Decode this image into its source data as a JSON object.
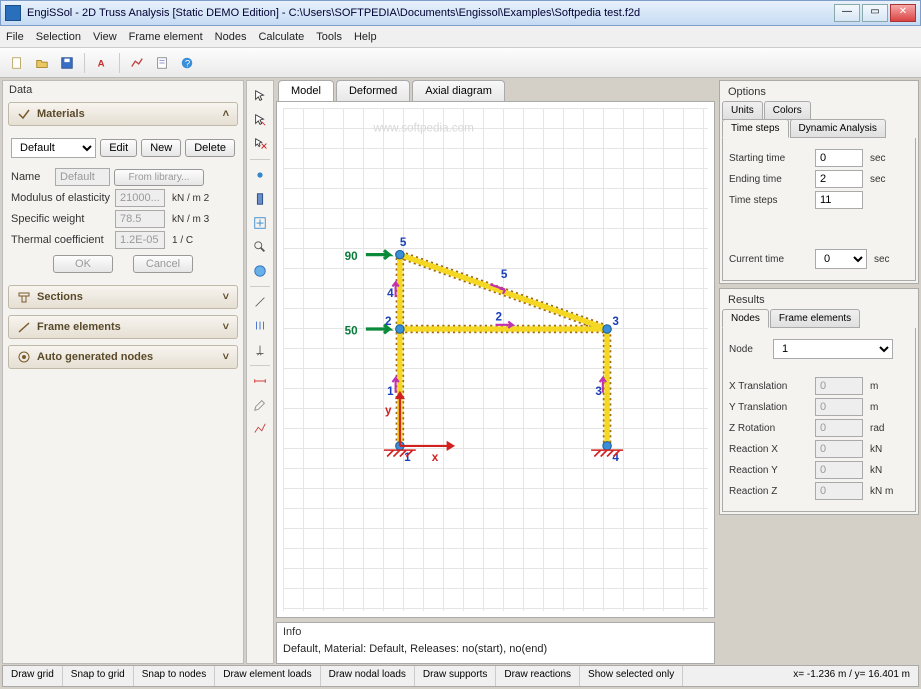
{
  "window": {
    "title": "EngiSSol - 2D Truss Analysis [Static DEMO Edition]   -  C:\\Users\\SOFTPEDIA\\Documents\\Engissol\\Examples\\Softpedia test.f2d"
  },
  "menu": [
    "File",
    "Selection",
    "View",
    "Frame element",
    "Nodes",
    "Calculate",
    "Tools",
    "Help"
  ],
  "data_panel": {
    "title": "Data",
    "sections": {
      "materials": {
        "label": "Materials",
        "combo": "Default",
        "btn_edit": "Edit",
        "btn_new": "New",
        "btn_delete": "Delete",
        "name_label": "Name",
        "name_value": "Default",
        "from_library": "From library...",
        "modulus_label": "Modulus of elasticity",
        "modulus_value": "21000...",
        "modulus_unit": "kN  /  m  2",
        "weight_label": "Specific weight",
        "weight_value": "78.5",
        "weight_unit": "kN  /  m  3",
        "thermal_label": "Thermal coefficient",
        "thermal_value": "1.2E-05",
        "thermal_unit": "1   /  C",
        "btn_ok": "OK",
        "btn_cancel": "Cancel"
      },
      "sections_label": "Sections",
      "frame_elements_label": "Frame elements",
      "auto_nodes_label": "Auto generated nodes"
    }
  },
  "center": {
    "tabs": [
      "Model",
      "Deformed",
      "Axial diagram"
    ],
    "watermark": "www.softpedia.com",
    "load_labels": {
      "top": "90",
      "mid": "50"
    },
    "node_labels": [
      "1",
      "2",
      "3",
      "4",
      "5"
    ],
    "element_labels": [
      "1",
      "2",
      "3",
      "4",
      "5"
    ],
    "axes": {
      "x": "x",
      "y": "y"
    },
    "info_title": "Info",
    "info_text": "Default, Material: Default, Releases: no(start), no(end)"
  },
  "options": {
    "title": "Options",
    "tabs": [
      "Units",
      "Colors",
      "Time steps",
      "Dynamic Analysis"
    ],
    "starting_time_label": "Starting time",
    "starting_time": "0",
    "ending_time_label": "Ending time",
    "ending_time": "2",
    "time_steps_label": "Time steps",
    "time_steps": "11",
    "current_time_label": "Current time",
    "current_time": "0",
    "sec": "sec"
  },
  "results": {
    "title": "Results",
    "tabs": [
      "Nodes",
      "Frame elements"
    ],
    "node_label": "Node",
    "node_value": "1",
    "rows": [
      {
        "label": "X Translation",
        "value": "0",
        "unit": "m"
      },
      {
        "label": "Y Translation",
        "value": "0",
        "unit": "m"
      },
      {
        "label": "Z Rotation",
        "value": "0",
        "unit": "rad"
      },
      {
        "label": "Reaction X",
        "value": "0",
        "unit": "kN"
      },
      {
        "label": "Reaction Y",
        "value": "0",
        "unit": "kN"
      },
      {
        "label": "Reaction Z",
        "value": "0",
        "unit": "kN m"
      }
    ]
  },
  "statusbar": {
    "buttons": [
      "Draw grid",
      "Snap to grid",
      "Snap to nodes",
      "Draw element loads",
      "Draw nodal loads",
      "Draw supports",
      "Draw reactions",
      "Show selected only"
    ],
    "coords": "x= -1.236 m / y= 16.401 m"
  }
}
